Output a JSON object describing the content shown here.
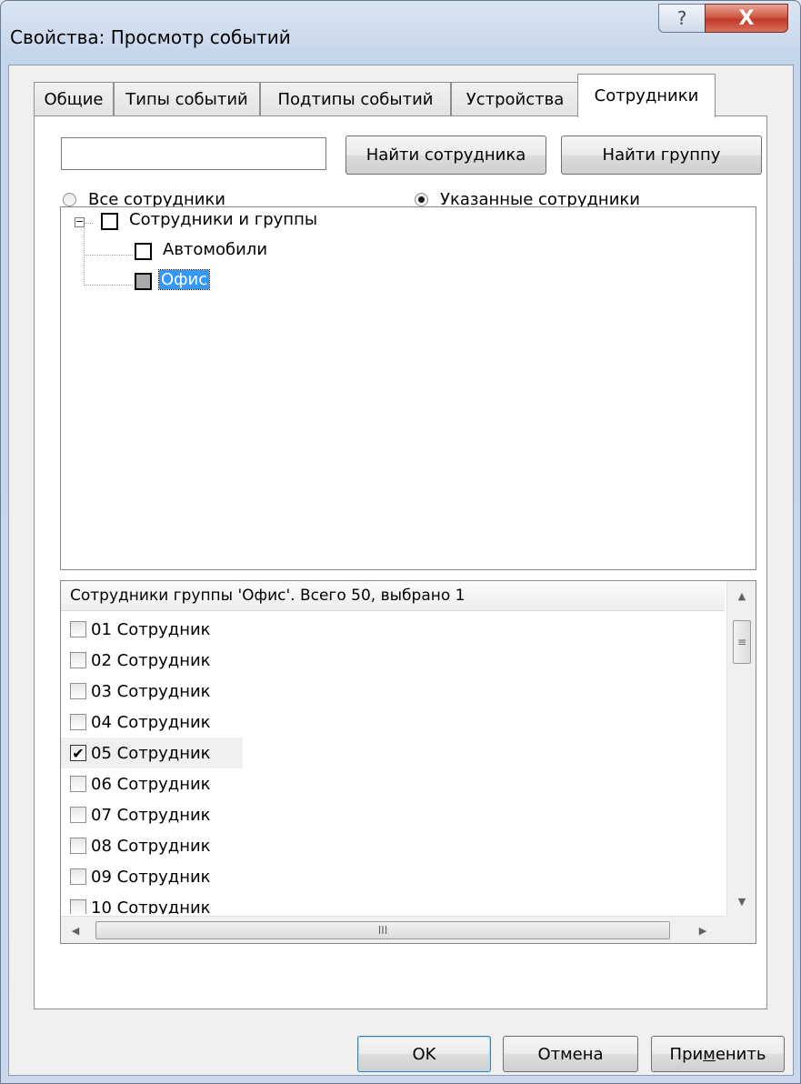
{
  "window": {
    "title": "Свойства: Просмотр событий",
    "help_glyph": "?",
    "close_glyph": "X"
  },
  "tabs": [
    {
      "label": "Общие",
      "active": false
    },
    {
      "label": "Типы событий",
      "active": false
    },
    {
      "label": "Подтипы событий",
      "active": false
    },
    {
      "label": "Устройства",
      "active": false
    },
    {
      "label": "Сотрудники",
      "active": true
    }
  ],
  "search": {
    "value": "",
    "find_employee_label": "Найти сотрудника",
    "find_group_label": "Найти группу"
  },
  "filter": {
    "all_label": "Все сотрудники",
    "specified_label": "Указанные сотрудники",
    "selected": "specified"
  },
  "tree": {
    "root": {
      "label": "Сотрудники и группы",
      "expander": "−",
      "check_state": "unchecked"
    },
    "children": [
      {
        "label": "Автомобили",
        "check_state": "unchecked",
        "selected": false
      },
      {
        "label": "Офис",
        "check_state": "mixed",
        "selected": true
      }
    ]
  },
  "employee_list": {
    "header": "Сотрудники группы 'Офис'. Всего 50, выбрано 1",
    "items": [
      {
        "label": "01 Сотрудник",
        "checked": false
      },
      {
        "label": "02 Сотрудник",
        "checked": false
      },
      {
        "label": "03 Сотрудник",
        "checked": false
      },
      {
        "label": "04 Сотрудник",
        "checked": false
      },
      {
        "label": "05 Сотрудник",
        "checked": true
      },
      {
        "label": "06 Сотрудник",
        "checked": false
      },
      {
        "label": "07 Сотрудник",
        "checked": false
      },
      {
        "label": "08 Сотрудник",
        "checked": false
      },
      {
        "label": "09 Сотрудник",
        "checked": false
      },
      {
        "label": "10 Сотрудник",
        "checked": false
      }
    ]
  },
  "footer": {
    "ok_label": "OK",
    "cancel_label": "Отмена",
    "apply_label_pre": "При",
    "apply_label_mnemonic": "м",
    "apply_label_post": "енить"
  },
  "glyphs": {
    "check": "✔",
    "arrow_up": "▲",
    "arrow_down": "▼",
    "arrow_left": "◀",
    "arrow_right": "▶",
    "grip_v": "≡",
    "grip_h": "III"
  },
  "colors": {
    "selection": "#3399ff",
    "close_button": "#c0392b",
    "frame": "#c9d8ec"
  }
}
